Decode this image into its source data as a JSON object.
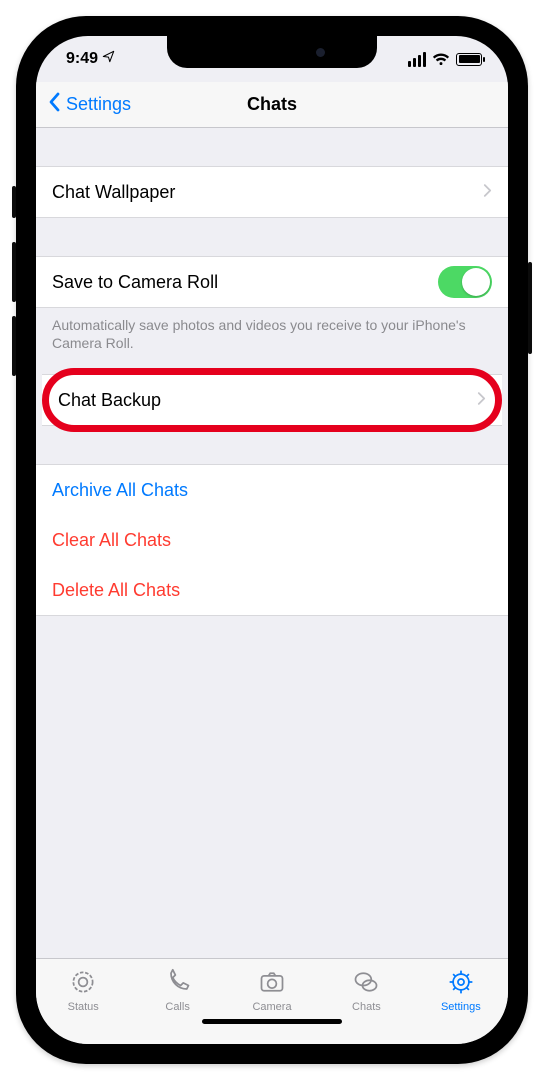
{
  "status": {
    "time": "9:49"
  },
  "nav": {
    "back": "Settings",
    "title": "Chats"
  },
  "cells": {
    "wallpaper": "Chat Wallpaper",
    "saveRoll": "Save to Camera Roll",
    "saveNote": "Automatically save photos and videos you receive to your iPhone's Camera Roll.",
    "backup": "Chat Backup",
    "archive": "Archive All Chats",
    "clear": "Clear All Chats",
    "del": "Delete All Chats"
  },
  "tabs": {
    "status": "Status",
    "calls": "Calls",
    "camera": "Camera",
    "chats": "Chats",
    "settings": "Settings"
  },
  "toggle": {
    "saveRoll": true
  },
  "colors": {
    "accent": "#007aff",
    "destructive": "#ff3b30",
    "toggleOn": "#4cd964",
    "highlight": "#e5001d"
  }
}
